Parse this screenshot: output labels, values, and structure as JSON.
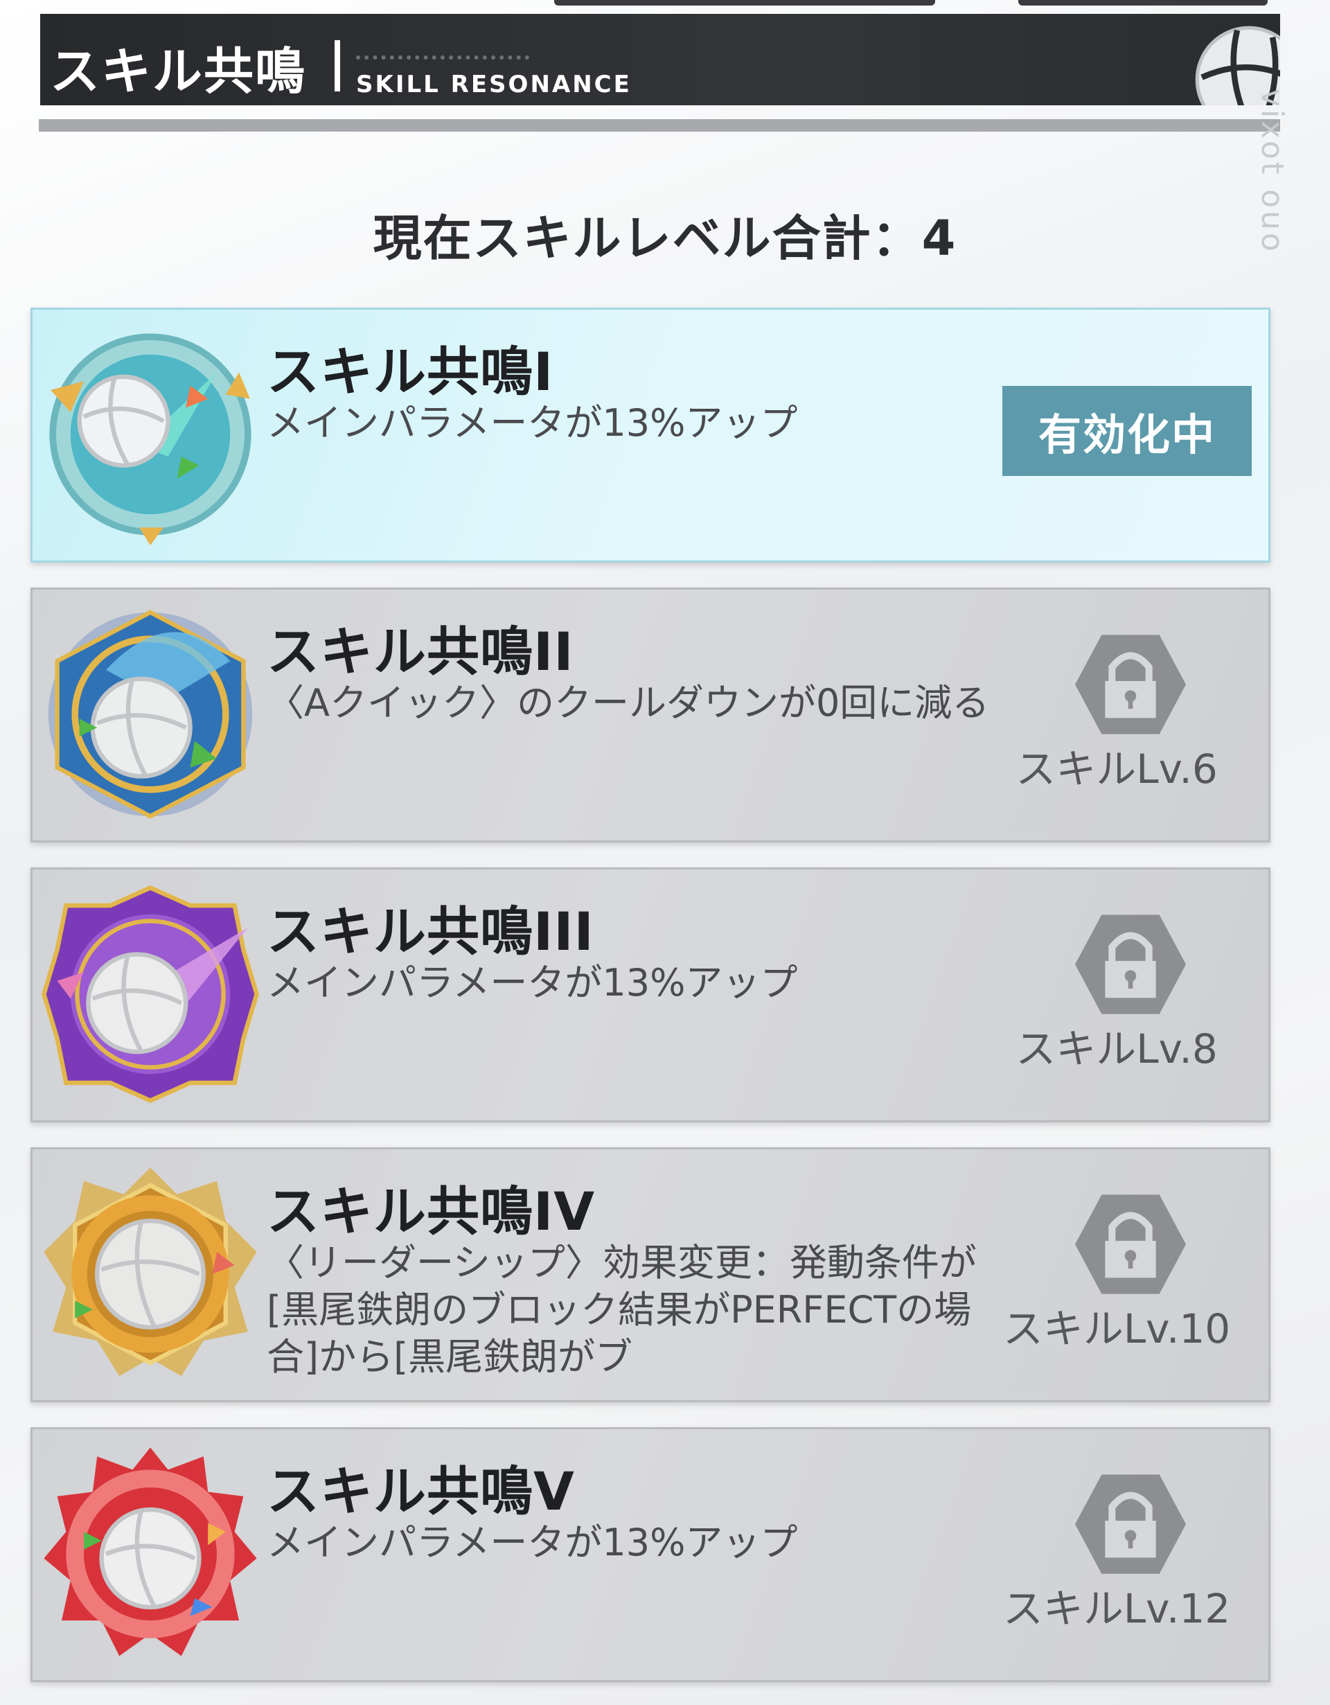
{
  "header": {
    "title": "スキル共鳴",
    "subtitle": "SKILL RESONANCE",
    "side_text": "vixot ouo"
  },
  "summary": {
    "text": "現在スキルレベル合計：4",
    "total_skill_level": 4
  },
  "colors": {
    "active_card": "#d4f4fa",
    "active_badge": "#5d9aab",
    "locked_card": "#d4d5d8",
    "header_bg": "#2c2e31"
  },
  "resonances": [
    {
      "title": "スキル共鳴I",
      "description": "メインパラメータが13%アップ",
      "status": "active",
      "status_label": "有効化中",
      "emblem": "teal-volleyball-emblem-icon",
      "accent": "#5fc6d1"
    },
    {
      "title": "スキル共鳴II",
      "description": "〈Aクイック〉のクールダウンが0回に減る",
      "status": "locked",
      "unlock_label": "スキルLv.6",
      "emblem": "blue-volleyball-emblem-icon",
      "accent": "#3f86c9"
    },
    {
      "title": "スキル共鳴III",
      "description": "メインパラメータが13%アップ",
      "status": "locked",
      "unlock_label": "スキルLv.8",
      "emblem": "purple-volleyball-emblem-icon",
      "accent": "#8e4bc7"
    },
    {
      "title": "スキル共鳴IV",
      "description": "〈リーダーシップ〉効果変更：発動条件が[黒尾鉄朗のブロック結果がPERFECTの場合]から[黒尾鉄朗がブ",
      "status": "locked",
      "unlock_label": "スキルLv.10",
      "emblem": "gold-volleyball-emblem-icon",
      "accent": "#d9a53a"
    },
    {
      "title": "スキル共鳴V",
      "description": "メインパラメータが13%アップ",
      "status": "locked",
      "unlock_label": "スキルLv.12",
      "emblem": "red-volleyball-emblem-icon",
      "accent": "#d83a3a"
    }
  ]
}
